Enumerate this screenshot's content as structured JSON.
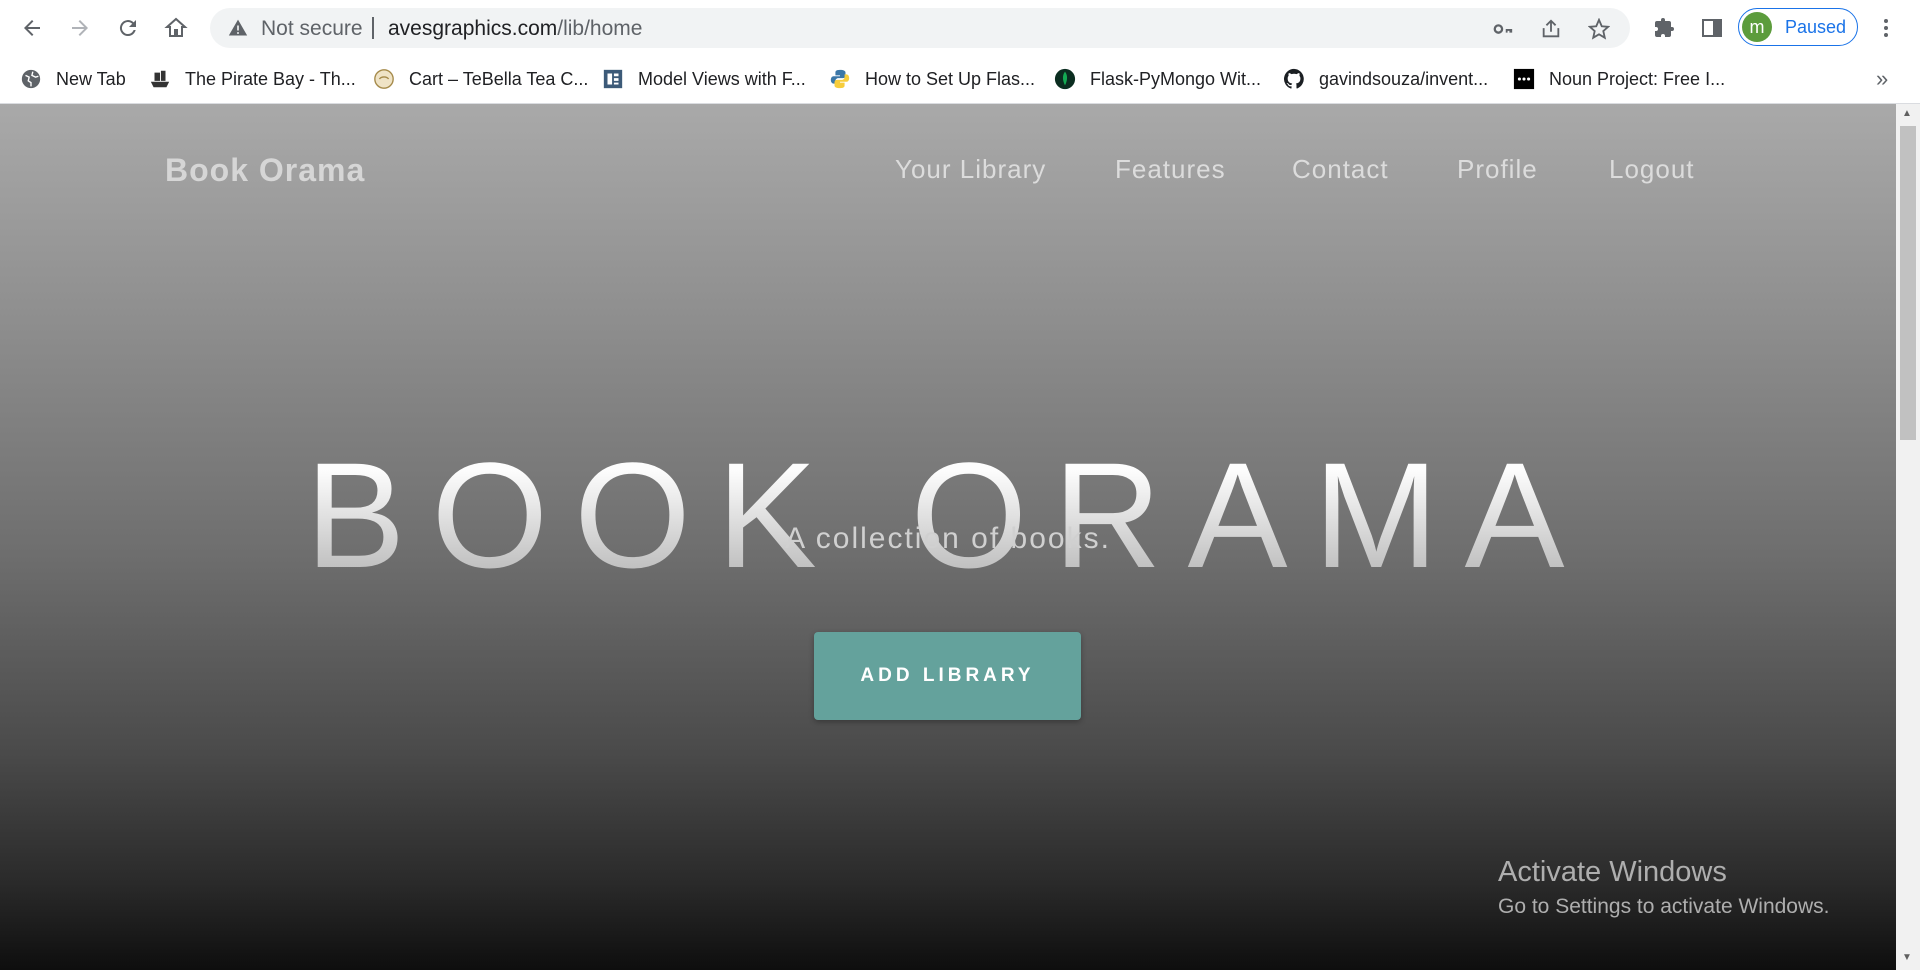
{
  "browser": {
    "address_warning": "Not secure",
    "url_host": "avesgraphics.com",
    "url_path": "/lib/home",
    "profile_initial": "m",
    "profile_status": "Paused"
  },
  "bookmarks": [
    {
      "label": "New Tab",
      "icon": "globe-icon"
    },
    {
      "label": "The Pirate Bay - Th...",
      "icon": "pirate-ship-icon"
    },
    {
      "label": "Cart – TeBella Tea C...",
      "icon": "tebella-logo-icon"
    },
    {
      "label": "Model Views with F...",
      "icon": "document-icon"
    },
    {
      "label": "How to Set Up Flas...",
      "icon": "python-icon"
    },
    {
      "label": "Flask-PyMongo Wit...",
      "icon": "mongodb-leaf-icon"
    },
    {
      "label": "gavindsouza/invent...",
      "icon": "github-icon"
    },
    {
      "label": "Noun Project: Free I...",
      "icon": "noun-project-icon"
    }
  ],
  "site": {
    "brand": "Book Orama",
    "nav": [
      "Your Library",
      "Features",
      "Contact",
      "Profile",
      "Logout"
    ],
    "hero_title": "BOOK ORAMA",
    "hero_subtitle": "A collection of books.",
    "cta_label": "ADD LIBRARY"
  },
  "watermark": {
    "line1": "Activate Windows",
    "line2": "Go to Settings to activate Windows."
  },
  "colors": {
    "cta": "#64a29c",
    "profile_accent": "#1a73e8",
    "avatar": "#5c9c3c"
  }
}
